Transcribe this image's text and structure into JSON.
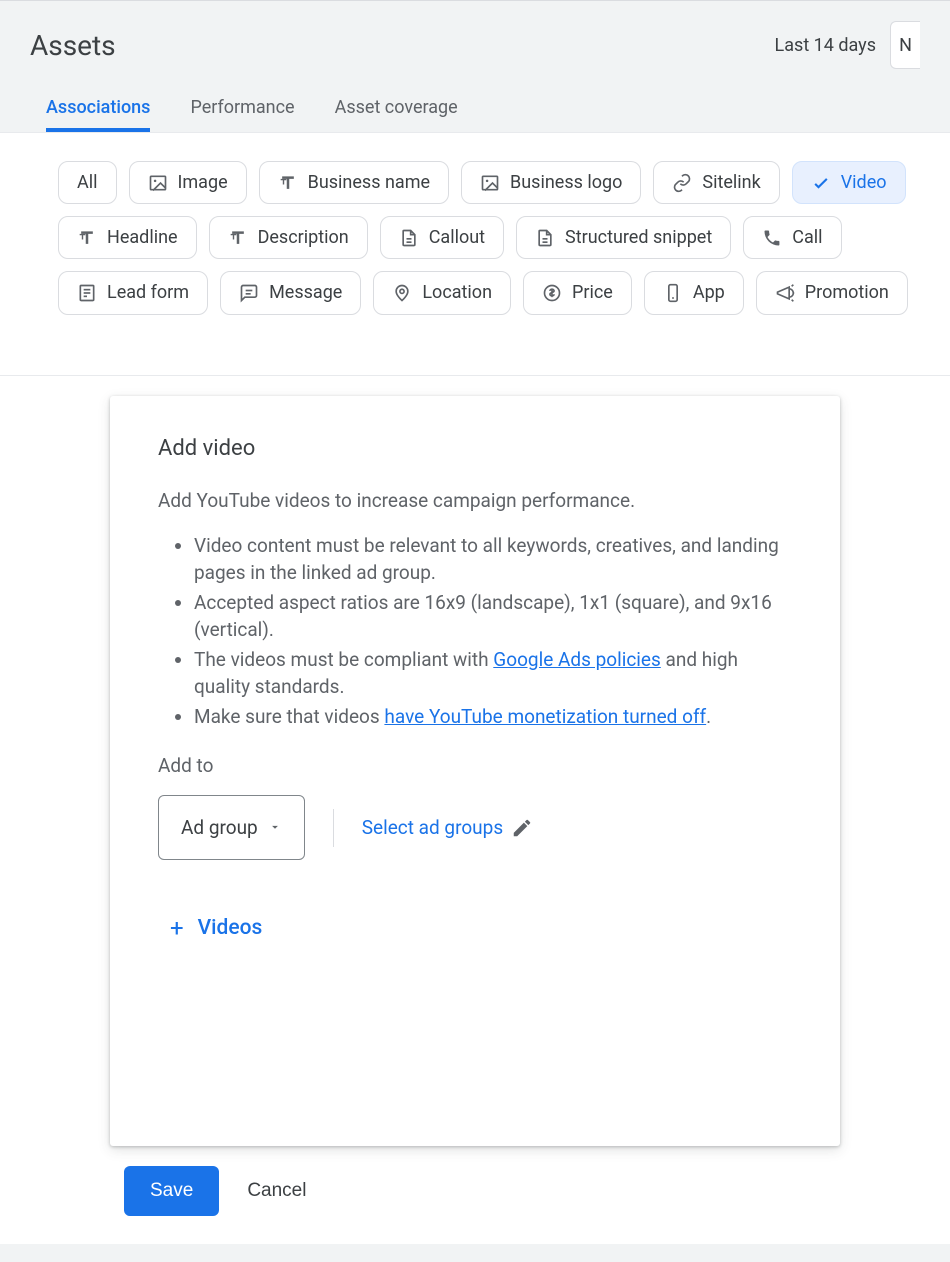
{
  "header": {
    "title": "Assets",
    "date_range": "Last 14 days",
    "truncated_next": "N"
  },
  "tabs": [
    {
      "label": "Associations",
      "active": true
    },
    {
      "label": "Performance",
      "active": false
    },
    {
      "label": "Asset coverage",
      "active": false
    }
  ],
  "chips": [
    {
      "label": "All",
      "icon": "",
      "selected": false
    },
    {
      "label": "Image",
      "icon": "image-icon",
      "selected": false
    },
    {
      "label": "Business name",
      "icon": "text-format-icon",
      "selected": false
    },
    {
      "label": "Business logo",
      "icon": "image-icon",
      "selected": false
    },
    {
      "label": "Sitelink",
      "icon": "link-icon",
      "selected": false
    },
    {
      "label": "Video",
      "icon": "check-icon",
      "selected": true
    },
    {
      "label": "Headline",
      "icon": "text-format-icon",
      "selected": false
    },
    {
      "label": "Description",
      "icon": "text-format-icon",
      "selected": false
    },
    {
      "label": "Callout",
      "icon": "document-icon",
      "selected": false
    },
    {
      "label": "Structured snippet",
      "icon": "document-icon",
      "selected": false
    },
    {
      "label": "Call",
      "icon": "phone-icon",
      "selected": false
    },
    {
      "label": "Lead form",
      "icon": "form-icon",
      "selected": false
    },
    {
      "label": "Message",
      "icon": "message-icon",
      "selected": false
    },
    {
      "label": "Location",
      "icon": "location-icon",
      "selected": false
    },
    {
      "label": "Price",
      "icon": "price-icon",
      "selected": false
    },
    {
      "label": "App",
      "icon": "app-icon",
      "selected": false
    },
    {
      "label": "Promotion",
      "icon": "promotion-icon",
      "selected": false
    }
  ],
  "card": {
    "title": "Add video",
    "intro": "Add YouTube videos to increase campaign performance.",
    "bullets": [
      {
        "before": "Video content must be relevant to all keywords, creatives, and landing pages in the linked ad group.",
        "link": "",
        "after": ""
      },
      {
        "before": "Accepted aspect ratios are 16x9 (landscape), 1x1 (square), and 9x16 (vertical).",
        "link": "",
        "after": ""
      },
      {
        "before": "The videos must be compliant with ",
        "link": "Google Ads policies",
        "after": " and high quality standards."
      },
      {
        "before": "Make sure that videos ",
        "link": "have YouTube monetization turned off",
        "after": "."
      }
    ],
    "addto_label": "Add to",
    "select_value": "Ad group",
    "select_link": "Select ad groups",
    "add_videos": "Videos"
  },
  "actions": {
    "save": "Save",
    "cancel": "Cancel"
  }
}
